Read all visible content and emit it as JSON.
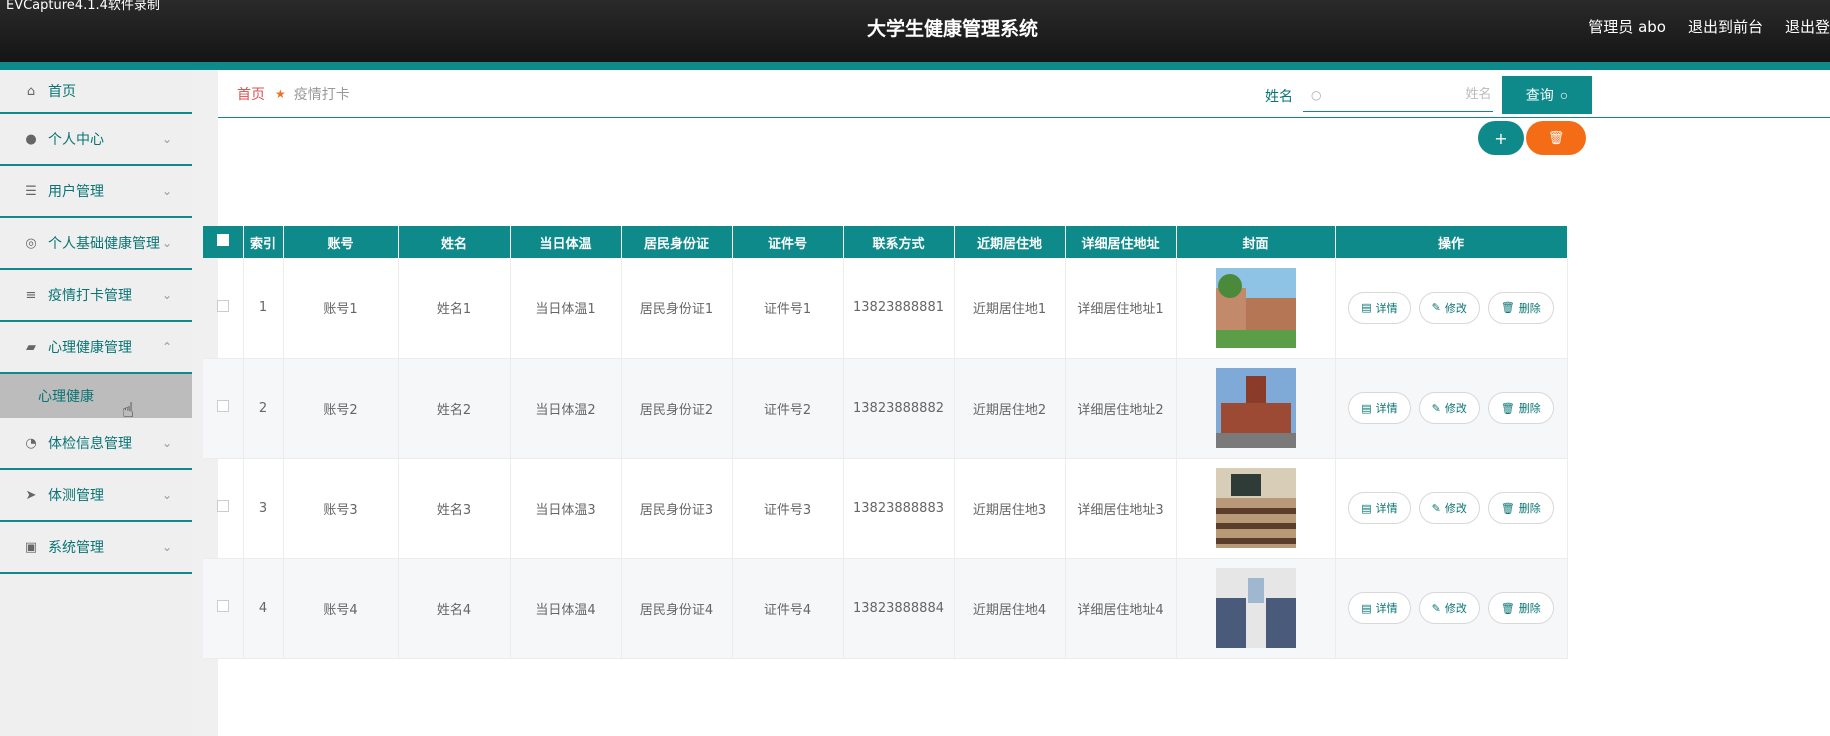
{
  "watermark": "EVCapture4.1.4软件录制",
  "header": {
    "title": "大学生健康管理系统",
    "user": "管理员 abo",
    "back_front": "退出到前台",
    "logout": "退出登"
  },
  "sidebar": {
    "items": [
      {
        "label": "首页",
        "icon": "home-icon",
        "chev": ""
      },
      {
        "label": "个人中心",
        "icon": "user-icon",
        "chev": "⌄"
      },
      {
        "label": "用户管理",
        "icon": "sliders-icon",
        "chev": "⌄"
      },
      {
        "label": "个人基础健康管理",
        "icon": "compass-icon",
        "chev": "⌄"
      },
      {
        "label": "疫情打卡管理",
        "icon": "list-icon",
        "chev": "⌄"
      },
      {
        "label": "心理健康管理",
        "icon": "message-icon",
        "chev": "⌃"
      },
      {
        "label": "体检信息管理",
        "icon": "gauge-icon",
        "chev": "⌄"
      },
      {
        "label": "体测管理",
        "icon": "send-icon",
        "chev": "⌄"
      },
      {
        "label": "系统管理",
        "icon": "clipboard-icon",
        "chev": "⌄"
      }
    ],
    "sub_item": "心理健康"
  },
  "breadcrumb": {
    "home": "首页",
    "current": "疫情打卡"
  },
  "search": {
    "label": "姓名",
    "placeholder": "姓名",
    "button": "查询"
  },
  "table": {
    "headers": [
      "索引",
      "账号",
      "姓名",
      "当日体温",
      "居民身份证",
      "证件号",
      "联系方式",
      "近期居住地",
      "详细居住地址",
      "封面",
      "操作"
    ],
    "rows": [
      {
        "index": "1",
        "account": "账号1",
        "name": "姓名1",
        "temp": "当日体温1",
        "idcard": "居民身份证1",
        "cert": "证件号1",
        "phone": "13823888881",
        "residence": "近期居住地1",
        "address": "详细居住地址1"
      },
      {
        "index": "2",
        "account": "账号2",
        "name": "姓名2",
        "temp": "当日体温2",
        "idcard": "居民身份证2",
        "cert": "证件号2",
        "phone": "13823888882",
        "residence": "近期居住地2",
        "address": "详细居住地址2"
      },
      {
        "index": "3",
        "account": "账号3",
        "name": "姓名3",
        "temp": "当日体温3",
        "idcard": "居民身份证3",
        "cert": "证件号3",
        "phone": "13823888883",
        "residence": "近期居住地3",
        "address": "详细居住地址3"
      },
      {
        "index": "4",
        "account": "账号4",
        "name": "姓名4",
        "temp": "当日体温4",
        "idcard": "居民身份证4",
        "cert": "证件号4",
        "phone": "13823888884",
        "residence": "近期居住地4",
        "address": "详细居住地址4"
      }
    ],
    "actions": {
      "detail": "详情",
      "edit": "修改",
      "delete": "删除"
    }
  },
  "colors": {
    "accent": "#0f8a8a",
    "danger": "#f56c16"
  }
}
